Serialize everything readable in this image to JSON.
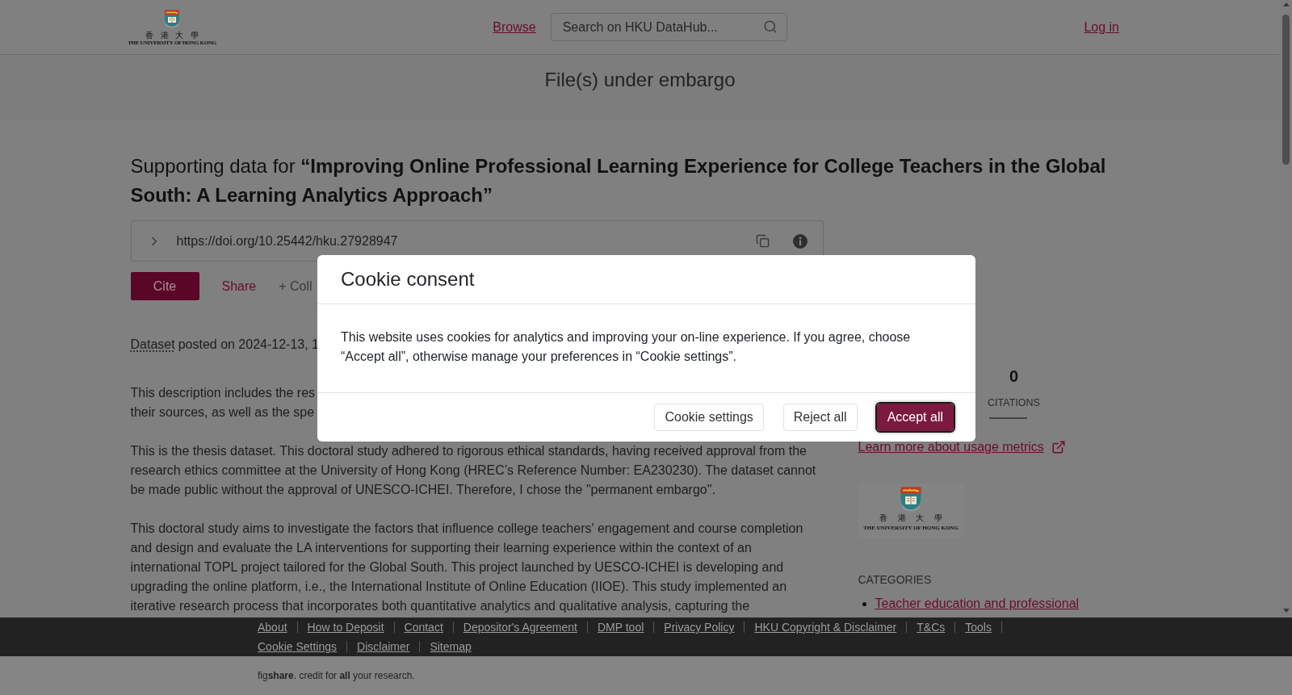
{
  "header": {
    "logo": {
      "chinese": "香 港 大 學",
      "english": "THE UNIVERSITY OF HONG KONG"
    },
    "nav_link": "Browse",
    "search": {
      "placeholder": "Search on HKU DataHub..."
    },
    "login_link": "Log in"
  },
  "banner": "File(s) under embargo",
  "item": {
    "title": "Supporting data for **“Improving Online Professional Learning Experience for College Teachers in the Global South: A Learning Analytics Approach”**",
    "doi": "https://doi.org/10.25442/hku.27928947",
    "actions": [
      {
        "kind": "primary",
        "label": "Cite"
      },
      {
        "kind": "link",
        "label": "Share"
      },
      {
        "kind": "muted",
        "label": "+ Coll"
      }
    ],
    "posted": {
      "type_link": "Dataset",
      "text": "posted on 2024-12-13, 1"
    },
    "description": [
      {
        "kind": "cut_lines",
        "lines": [
          "This description includes the res",
          "their sources, as well as the spe"
        ]
      },
      {
        "kind": "paragraph",
        "text": "This is the thesis dataset. This doctoral study adhered to rigorous ethical standards, having received approval from the research ethics committee at the University of Hong Kong (HREC’s Reference Number: EA230230). The dataset cannot be made public without the approval of UNESCO-ICHEI. Therefore, I chose the \"permanent embargo\"."
      },
      {
        "kind": "paragraph",
        "text": "This doctoral study aims to investigate the factors that influence college teachers' engagement and course completion and design and evaluate the LA interventions for supporting their learning experience within the context of an international TOPL project tailored for the Global South. This project launched by UESCO-ICHEI is developing and upgrading the online platform, i.e., the International Institute of Online Education (IIOE). This study implemented an iterative research process that incorporates both quantitative analytics and qualitative analysis, capturing the"
      }
    ]
  },
  "sidebar": {
    "metrics": [
      {
        "value": "0",
        "label": "CITATIONS"
      }
    ],
    "usage_link": "Learn more about usage metrics",
    "logo": {
      "chinese": "香 港 大 學",
      "english": "THE UNIVERSITY OF HONG KONG"
    },
    "categories": {
      "heading": "CATEGORIES",
      "items": [
        "Teacher education and professional"
      ]
    }
  },
  "cookie_dialog": {
    "title": "Cookie consent",
    "body": "This website uses cookies for analytics and improving your on-line experience. If you agree, choose “Accept all”, otherwise manage your preferences in “Cookie settings”.",
    "buttons": [
      {
        "kind": "secondary",
        "label": "Cookie settings",
        "focused": false
      },
      {
        "kind": "secondary",
        "label": "Reject all",
        "focused": false
      },
      {
        "kind": "primary",
        "label": "Accept all",
        "focused": true
      }
    ]
  },
  "footer": {
    "links": [
      "About",
      "How to Deposit",
      "Contact",
      "Depositor's Agreement",
      "DMP tool",
      "Privacy Policy",
      "HKU Copyright & Disclaimer",
      "T&Cs",
      "Tools",
      "Cookie Settings",
      "Disclaimer",
      "Sitemap"
    ],
    "credit": "fig**share**. credit for **all** your research."
  }
}
